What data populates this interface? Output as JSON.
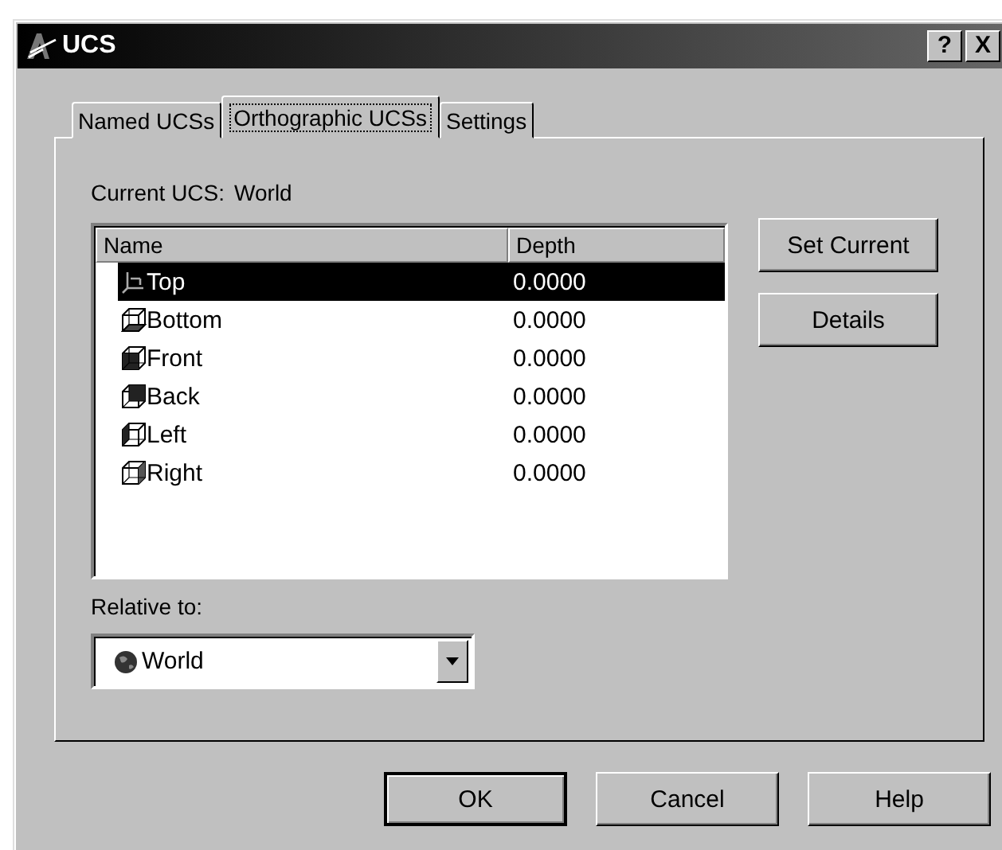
{
  "window": {
    "title": "UCS",
    "title_buttons": [
      "?",
      "X"
    ]
  },
  "tabs": [
    {
      "label": "Named UCSs",
      "selected": false
    },
    {
      "label": "Orthographic UCSs",
      "selected": true
    },
    {
      "label": "Settings",
      "selected": false
    }
  ],
  "current_ucs": {
    "label": "Current UCS:",
    "value": "World"
  },
  "list": {
    "columns": [
      "Name",
      "Depth"
    ],
    "rows": [
      {
        "kind": "top",
        "name": "Top",
        "depth": "0.0000",
        "selected": true
      },
      {
        "kind": "bottom",
        "name": "Bottom",
        "depth": "0.0000",
        "selected": false
      },
      {
        "kind": "front",
        "name": "Front",
        "depth": "0.0000",
        "selected": false
      },
      {
        "kind": "back",
        "name": "Back",
        "depth": "0.0000",
        "selected": false
      },
      {
        "kind": "left",
        "name": "Left",
        "depth": "0.0000",
        "selected": false
      },
      {
        "kind": "right",
        "name": "Right",
        "depth": "0.0000",
        "selected": false
      }
    ]
  },
  "side_buttons": [
    "Set Current",
    "Details"
  ],
  "relative_to": {
    "label": "Relative to:",
    "value": "World"
  },
  "buttons": [
    {
      "label": "OK",
      "default": true
    },
    {
      "label": "Cancel",
      "default": false
    },
    {
      "label": "Help",
      "default": false
    }
  ]
}
